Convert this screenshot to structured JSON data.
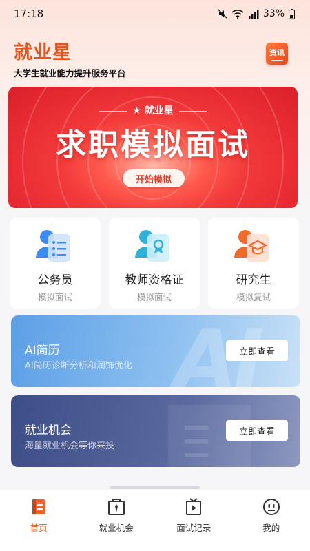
{
  "status_bar": {
    "time": "17:18",
    "battery": "33%"
  },
  "header": {
    "brand": "就业星",
    "tagline": "大学生就业能力提升服务平台",
    "news_label": "资讯"
  },
  "banner": {
    "subtitle": "★ 就业星",
    "title": "求职模拟面试",
    "button": "开始模拟"
  },
  "categories": [
    {
      "title": "公务员",
      "sub": "模拟面试"
    },
    {
      "title": "教师资格证",
      "sub": "模拟面试"
    },
    {
      "title": "研究生",
      "sub": "模拟复试"
    }
  ],
  "features": {
    "ai_resume": {
      "title": "AI简历",
      "desc": "AI简历诊断分析和润饰优化",
      "button": "立即查看",
      "bg_text": "AI"
    },
    "jobs": {
      "title": "就业机会",
      "desc": "海量就业机会等你来投",
      "button": "立即查看"
    }
  },
  "tabs": [
    {
      "label": "首页",
      "icon": "home-book-icon",
      "active": true
    },
    {
      "label": "就业机会",
      "icon": "briefcase-tie-icon"
    },
    {
      "label": "面试记录",
      "icon": "video-play-icon"
    },
    {
      "label": "我的",
      "icon": "smiley-face-icon"
    }
  ],
  "colors": {
    "accent": "#e8541e",
    "banner_red": "#e92c33",
    "ai_blue": "#5c9fe6",
    "job_navy": "#3d4d86"
  }
}
